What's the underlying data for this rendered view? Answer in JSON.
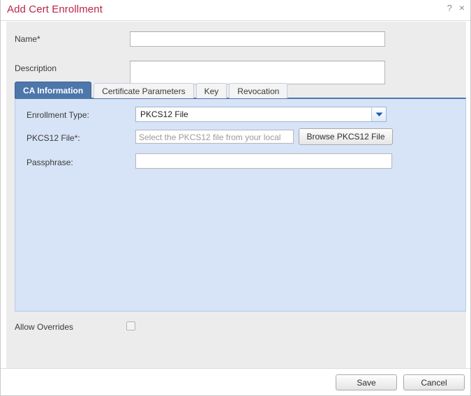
{
  "window": {
    "title": "Add Cert Enrollment",
    "title_color": "#bb2649",
    "help_icon": "?",
    "close_icon": "×"
  },
  "form": {
    "name": {
      "label": "Name*",
      "value": "",
      "placeholder": ""
    },
    "description": {
      "label": "Description",
      "value": "",
      "placeholder": ""
    }
  },
  "tabs": [
    {
      "label": "CA Information",
      "active": true
    },
    {
      "label": "Certificate Parameters",
      "active": false
    },
    {
      "label": "Key",
      "active": false
    },
    {
      "label": "Revocation",
      "active": false
    }
  ],
  "ca_information": {
    "enrollment_type": {
      "label": "Enrollment Type:",
      "selected": "PKCS12 File",
      "dropdown_icon": "chevron-down-icon"
    },
    "pkcs12_file": {
      "label": "PKCS12 File*:",
      "value": "",
      "placeholder": "Select the PKCS12 file from your local",
      "browse_button": "Browse PKCS12 File"
    },
    "passphrase": {
      "label": "Passphrase:",
      "value": ""
    }
  },
  "allow_overrides": {
    "label": "Allow Overrides",
    "checked": false
  },
  "footer": {
    "save_label": "Save",
    "cancel_label": "Cancel"
  },
  "colors": {
    "accent_blue": "#4d76ab",
    "panel_blue": "#d7e3f7",
    "body_gray": "#ececec",
    "title_crimson": "#bb2649"
  }
}
